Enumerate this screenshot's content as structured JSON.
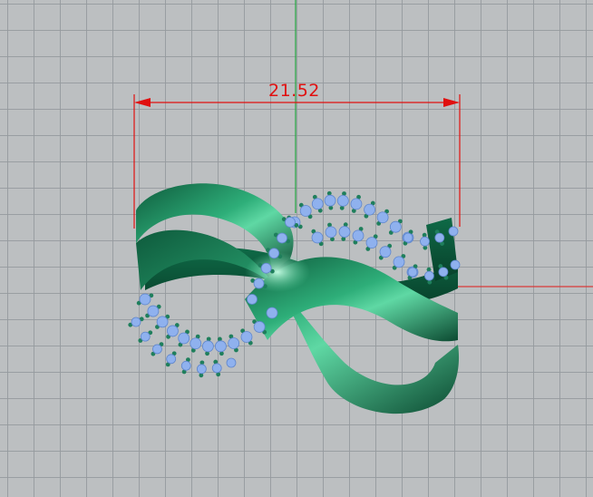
{
  "viewport": {
    "name": "perspective-viewport",
    "grid_color": "#969a9e",
    "background_color": "#bcbfc1"
  },
  "axes": {
    "y_axis_color": "#2fa84a",
    "x_axis_color": "#d83a3a"
  },
  "dimension": {
    "value": "21.52",
    "color": "#e01010"
  },
  "model": {
    "name": "ring-model",
    "metal_color": "#1e8a5e",
    "stone_color": "#8fb1ee",
    "prong_color": "#1f7f5c"
  }
}
